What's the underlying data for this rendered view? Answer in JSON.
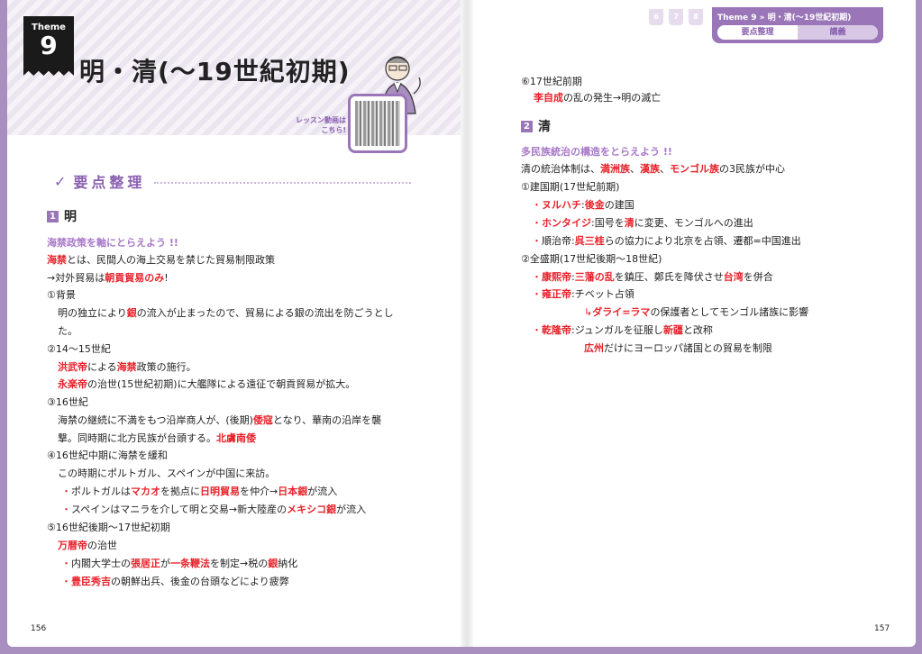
{
  "header": {
    "theme_label": "Theme",
    "theme_number": "9",
    "title": "明・清(〜19世紀初期)",
    "lesson_text_1": "レッスン動画は",
    "lesson_text_2": "こちら!"
  },
  "left": {
    "section_label": "要点整理",
    "sub1_num": "1",
    "sub1_title": "明",
    "lines": [
      {
        "parts": [
          {
            "t": "海禁政策を軸にとらえよう !!",
            "c": "focus"
          }
        ]
      },
      {
        "parts": [
          {
            "t": "海禁",
            "c": "red"
          },
          {
            "t": "とは、民間人の海上交易を禁じた貿易制限政策",
            "c": ""
          }
        ]
      },
      {
        "parts": [
          {
            "t": "→対外貿易は",
            "c": ""
          },
          {
            "t": "朝貢貿易のみ",
            "c": "red"
          },
          {
            "t": "!",
            "c": ""
          }
        ]
      },
      {
        "parts": [
          {
            "t": "①背景",
            "c": ""
          }
        ]
      },
      {
        "parts": [
          {
            "t": "明の独立により",
            "c": ""
          },
          {
            "t": "銀",
            "c": "red"
          },
          {
            "t": "の流入が止まったので、貿易による銀の流出を防ごうとし",
            "c": ""
          }
        ]
      },
      {
        "parts": [
          {
            "t": "た。",
            "c": ""
          }
        ]
      },
      {
        "parts": [
          {
            "t": "②14〜15世紀",
            "c": ""
          }
        ]
      },
      {
        "parts": [
          {
            "t": "洪武帝",
            "c": "red"
          },
          {
            "t": "による",
            "c": ""
          },
          {
            "t": "海禁",
            "c": "red"
          },
          {
            "t": "政策の施行。",
            "c": ""
          }
        ]
      },
      {
        "parts": [
          {
            "t": "永楽帝",
            "c": "red"
          },
          {
            "t": "の治世(15世紀初期)に大艦隊による遠征で朝貢貿易が拡大。",
            "c": ""
          }
        ]
      },
      {
        "parts": [
          {
            "t": "③16世紀",
            "c": ""
          }
        ]
      },
      {
        "parts": [
          {
            "t": "海禁の継続に不満をもつ沿岸商人が、(後期)",
            "c": ""
          },
          {
            "t": "倭寇",
            "c": "red"
          },
          {
            "t": "となり、華南の沿岸を襲",
            "c": ""
          }
        ]
      },
      {
        "parts": [
          {
            "t": "撃。同時期に北方民族が台頭する。",
            "c": ""
          },
          {
            "t": "北虜南倭",
            "c": "red"
          }
        ]
      },
      {
        "parts": [
          {
            "t": "④16世紀中期に海禁を緩和",
            "c": ""
          }
        ]
      },
      {
        "parts": [
          {
            "t": "この時期にポルトガル、スペインが中国に来訪。",
            "c": ""
          }
        ]
      },
      {
        "parts": [
          {
            "t": "・",
            "c": "bul"
          },
          {
            "t": "ポルトガルは",
            "c": ""
          },
          {
            "t": "マカオ",
            "c": "red"
          },
          {
            "t": "を拠点に",
            "c": ""
          },
          {
            "t": "日明貿易",
            "c": "red"
          },
          {
            "t": "を仲介→",
            "c": ""
          },
          {
            "t": "日本銀",
            "c": "red"
          },
          {
            "t": "が流入",
            "c": ""
          }
        ]
      },
      {
        "parts": [
          {
            "t": "・",
            "c": "bul"
          },
          {
            "t": "スペインはマニラを介して明と交易→新大陸産の",
            "c": ""
          },
          {
            "t": "メキシコ銀",
            "c": "red"
          },
          {
            "t": "が流入",
            "c": ""
          }
        ]
      },
      {
        "parts": [
          {
            "t": "⑤16世紀後期〜17世紀初期",
            "c": ""
          }
        ]
      },
      {
        "parts": [
          {
            "t": "万暦帝",
            "c": "red"
          },
          {
            "t": "の治世",
            "c": ""
          }
        ]
      },
      {
        "parts": [
          {
            "t": "・",
            "c": "bul"
          },
          {
            "t": "内閣大学士の",
            "c": ""
          },
          {
            "t": "張居正",
            "c": "red"
          },
          {
            "t": "が",
            "c": ""
          },
          {
            "t": "一条鞭法",
            "c": "red"
          },
          {
            "t": "を制定→税の",
            "c": ""
          },
          {
            "t": "銀",
            "c": "red"
          },
          {
            "t": "納化",
            "c": ""
          }
        ]
      },
      {
        "parts": [
          {
            "t": "・",
            "c": "bul"
          },
          {
            "t": "豊臣秀吉",
            "c": "red"
          },
          {
            "t": "の朝鮮出兵、後金の台頭などにより疲弊",
            "c": ""
          }
        ]
      }
    ],
    "folio": "156"
  },
  "right": {
    "nav_title": "Theme 9 » 明・清(〜19世紀初期)",
    "nav_tab_1": "要点整理",
    "nav_tab_2": "講義",
    "chips": [
      "6",
      "7",
      "8"
    ],
    "sub2_num": "2",
    "sub2_title": "清",
    "pre_lines": [
      {
        "parts": [
          {
            "t": "⑥17世紀前期",
            "c": ""
          }
        ]
      },
      {
        "parts": [
          {
            "t": "李自成",
            "c": "red"
          },
          {
            "t": "の乱の発生→明の滅亡",
            "c": ""
          }
        ]
      }
    ],
    "lines": [
      {
        "parts": [
          {
            "t": "多民族統治の構造をとらえよう !!",
            "c": "focus"
          }
        ]
      },
      {
        "parts": [
          {
            "t": "清の統治体制は、",
            "c": ""
          },
          {
            "t": "満洲族",
            "c": "red"
          },
          {
            "t": "、",
            "c": ""
          },
          {
            "t": "漢族",
            "c": "red"
          },
          {
            "t": "、",
            "c": ""
          },
          {
            "t": "モンゴル族",
            "c": "red"
          },
          {
            "t": "の3民族が中心",
            "c": ""
          }
        ]
      },
      {
        "parts": [
          {
            "t": "①建国期(17世紀前期)",
            "c": ""
          }
        ]
      },
      {
        "parts": [
          {
            "t": "・",
            "c": "bul"
          },
          {
            "t": "ヌルハチ",
            "c": "red"
          },
          {
            "t": ":",
            "c": ""
          },
          {
            "t": "後金",
            "c": "red"
          },
          {
            "t": "の建国",
            "c": ""
          }
        ]
      },
      {
        "parts": [
          {
            "t": "・",
            "c": "bul"
          },
          {
            "t": "ホンタイジ",
            "c": "red"
          },
          {
            "t": ":国号を",
            "c": ""
          },
          {
            "t": "清",
            "c": "red"
          },
          {
            "t": "に変更、モンゴルへの進出",
            "c": ""
          }
        ]
      },
      {
        "parts": [
          {
            "t": "・",
            "c": "bul"
          },
          {
            "t": "順治帝:",
            "c": ""
          },
          {
            "t": "呉三桂",
            "c": "red"
          },
          {
            "t": "らの協力により北京を占領、遷都=中国進出",
            "c": ""
          }
        ]
      },
      {
        "parts": [
          {
            "t": "②全盛期(17世紀後期〜18世紀)",
            "c": ""
          }
        ]
      },
      {
        "parts": [
          {
            "t": "・",
            "c": "bul"
          },
          {
            "t": "康熙帝",
            "c": "red"
          },
          {
            "t": ":",
            "c": ""
          },
          {
            "t": "三藩の乱",
            "c": "red"
          },
          {
            "t": "を鎮圧、鄭氏を降伏させ",
            "c": ""
          },
          {
            "t": "台湾",
            "c": "red"
          },
          {
            "t": "を併合",
            "c": ""
          }
        ]
      },
      {
        "parts": [
          {
            "t": "・",
            "c": "bul"
          },
          {
            "t": "雍正帝",
            "c": "red"
          },
          {
            "t": ":チベット占領",
            "c": ""
          }
        ]
      },
      {
        "parts": [
          {
            "t": "↳",
            "c": "arr"
          },
          {
            "t": "ダライ=ラマ",
            "c": "red"
          },
          {
            "t": "の保護者としてモンゴル諸族に影響",
            "c": ""
          }
        ]
      },
      {
        "parts": [
          {
            "t": "・",
            "c": "bul"
          },
          {
            "t": "乾隆帝",
            "c": "red"
          },
          {
            "t": ":ジュンガルを征服し",
            "c": ""
          },
          {
            "t": "新疆",
            "c": "red"
          },
          {
            "t": "と改称",
            "c": ""
          }
        ]
      },
      {
        "parts": [
          {
            "t": "広州",
            "c": "red"
          },
          {
            "t": "だけにヨーロッパ諸国との貿易を制限",
            "c": ""
          }
        ]
      }
    ],
    "folio": "157"
  },
  "colors": {
    "accent": "#9a76b8",
    "red": "#e8222a",
    "focus": "#a878c8"
  }
}
